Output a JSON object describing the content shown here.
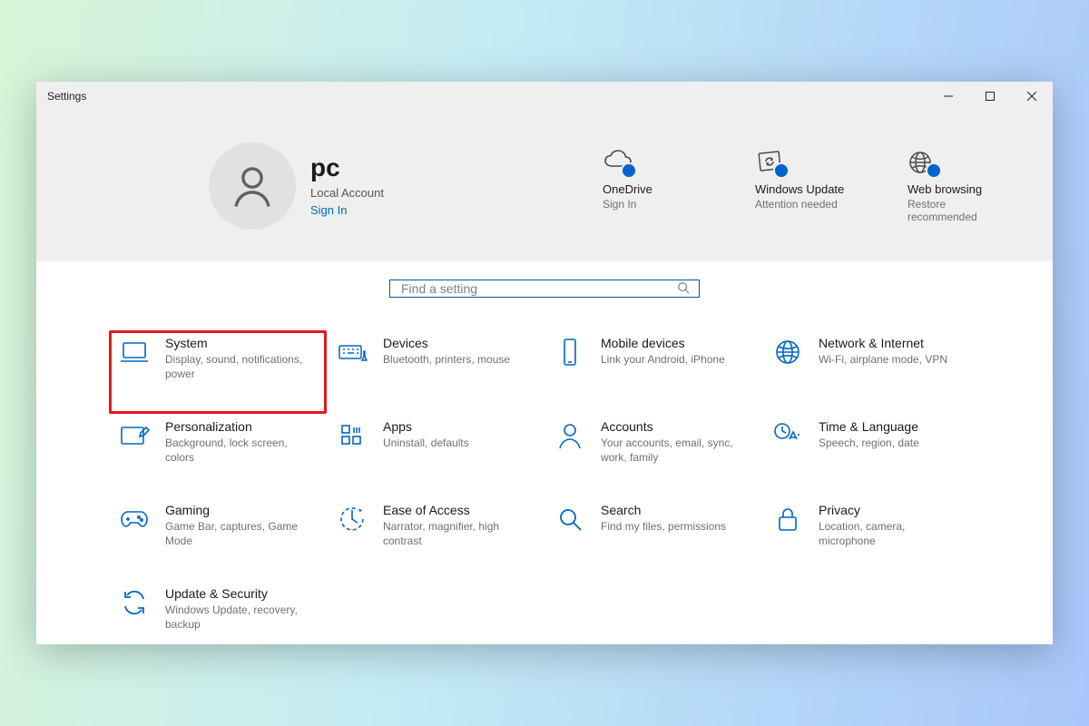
{
  "window": {
    "title": "Settings"
  },
  "user": {
    "username": "pc",
    "account_type": "Local Account",
    "signin_label": "Sign In"
  },
  "header_status": [
    {
      "title": "OneDrive",
      "sub": "Sign In",
      "icon": "cloud-icon"
    },
    {
      "title": "Windows Update",
      "sub": "Attention needed",
      "icon": "update-icon"
    },
    {
      "title": "Web browsing",
      "sub": "Restore recommended",
      "icon": "globe-icon"
    }
  ],
  "search": {
    "placeholder": "Find a setting"
  },
  "categories": [
    {
      "title": "System",
      "desc": "Display, sound, notifications, power",
      "icon": "laptop-icon",
      "highlight": true
    },
    {
      "title": "Devices",
      "desc": "Bluetooth, printers, mouse",
      "icon": "keyboard-icon"
    },
    {
      "title": "Mobile devices",
      "desc": "Link your Android, iPhone",
      "icon": "phone-icon"
    },
    {
      "title": "Network & Internet",
      "desc": "Wi-Fi, airplane mode, VPN",
      "icon": "network-globe-icon"
    },
    {
      "title": "Personalization",
      "desc": "Background, lock screen, colors",
      "icon": "personalization-icon"
    },
    {
      "title": "Apps",
      "desc": "Uninstall, defaults",
      "icon": "apps-icon"
    },
    {
      "title": "Accounts",
      "desc": "Your accounts, email, sync, work, family",
      "icon": "accounts-icon"
    },
    {
      "title": "Time & Language",
      "desc": "Speech, region, date",
      "icon": "time-language-icon"
    },
    {
      "title": "Gaming",
      "desc": "Game Bar, captures, Game Mode",
      "icon": "gaming-icon"
    },
    {
      "title": "Ease of Access",
      "desc": "Narrator, magnifier, high contrast",
      "icon": "ease-of-access-icon"
    },
    {
      "title": "Search",
      "desc": "Find my files, permissions",
      "icon": "search-category-icon"
    },
    {
      "title": "Privacy",
      "desc": "Location, camera, microphone",
      "icon": "privacy-icon"
    },
    {
      "title": "Update & Security",
      "desc": "Windows Update, recovery, backup",
      "icon": "update-security-icon"
    }
  ]
}
